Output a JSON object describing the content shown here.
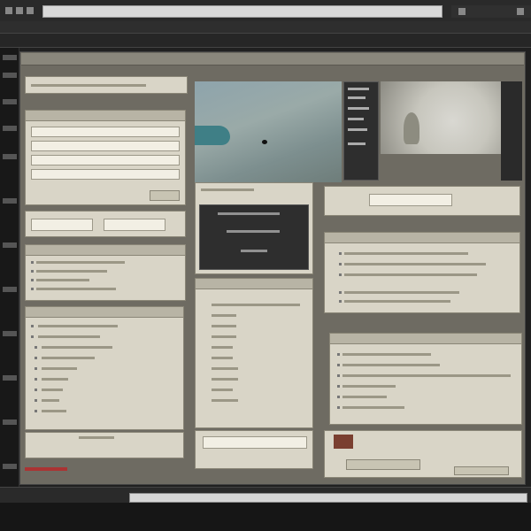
{
  "browser": {
    "url_text": ""
  },
  "colors": {
    "workspace": "#6e6b62",
    "panel": "#d9d5c7",
    "panel_header": "#b8b4a5",
    "dark": "#2e2e2e"
  },
  "icons": [
    "menu-icon",
    "back-icon",
    "forward-icon",
    "settings-icon",
    "close-icon"
  ]
}
